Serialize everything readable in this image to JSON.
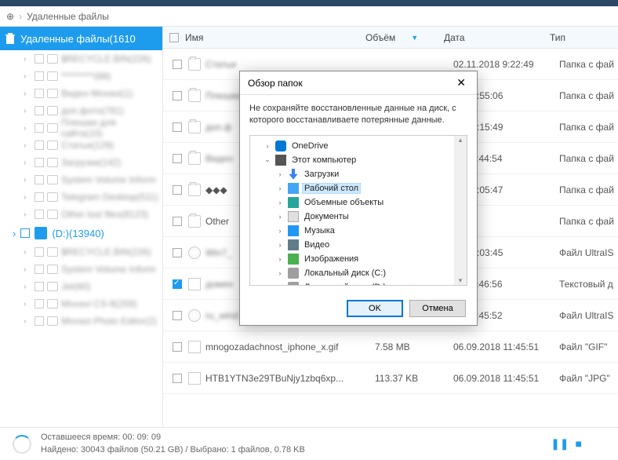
{
  "breadcrumb": {
    "title": "Удаленные файлы"
  },
  "sidebar": {
    "header": "Удаленные файлы(1610",
    "items": [
      "$RECYCLE.BIN(226)",
      "*********(68)",
      "Видео Movavi(1)",
      "доп.фото(781)",
      "Плюшки для сайта(10)",
      "Статьи(129)",
      "Загрузки(142)",
      "System Volume Inform",
      "Telegram Desktop(511)",
      "Other lost files(8123)"
    ],
    "disk_label": "(D:)(13940)",
    "items2": [
      "$RECYCLE.BIN(226)",
      "System Volume Inform",
      "Jet(60)",
      "Movavi CS-8(259)",
      "Movavi Photo Editor(2)"
    ]
  },
  "columns": {
    "name": "Имя",
    "size": "Объём",
    "date": "Дата",
    "type": "Тип"
  },
  "rows": [
    {
      "checked": false,
      "icon": "folder",
      "name": "Статьи",
      "blur": true,
      "size": "",
      "date": "02.11.2018 9:22:49",
      "type": "Папка с фай"
    },
    {
      "checked": false,
      "icon": "folder",
      "name": "Плюшки",
      "blur": true,
      "size": "",
      "date": "18 17:55:06",
      "type": "Папка с фай"
    },
    {
      "checked": false,
      "icon": "folder",
      "name": "доп.ф",
      "blur": true,
      "size": "",
      "date": "18 12:15:49",
      "type": "Папка с фай"
    },
    {
      "checked": false,
      "icon": "folder",
      "name": "Видео",
      "blur": true,
      "size": "",
      "date": "18 11:44:54",
      "type": "Папка с фай"
    },
    {
      "checked": false,
      "icon": "folder",
      "name": "◆◆◆",
      "blur": false,
      "size": "",
      "date": "18 15:05:47",
      "type": "Папка с фай"
    },
    {
      "checked": false,
      "icon": "folder",
      "name": "Other",
      "blur": false,
      "size": "",
      "date": "",
      "type": "Папка с фай"
    },
    {
      "checked": false,
      "icon": "iso",
      "name": "Win7_",
      "blur": true,
      "size": "",
      "date": "18 14:03:45",
      "type": "Файл UltraIS"
    },
    {
      "checked": true,
      "icon": "doc",
      "name": "домен",
      "blur": true,
      "size": "",
      "date": "18 11:46:56",
      "type": "Текстовый д"
    },
    {
      "checked": false,
      "icon": "iso",
      "name": "ru_wind",
      "blur": true,
      "size": "",
      "date": "18 11:45:52",
      "type": "Файл UltraIS"
    },
    {
      "checked": false,
      "icon": "doc",
      "name": "mnogozadachnost_iphone_x.gif",
      "blur": false,
      "size": "7.58 MB",
      "date": "06.09.2018 11:45:51",
      "type": "Файл \"GIF\""
    },
    {
      "checked": false,
      "icon": "doc",
      "name": "HTB1YTN3e29TBuNjy1zbq6xp...",
      "blur": false,
      "size": "113.37 KB",
      "date": "06.09.2018 11:45:51",
      "type": "Файл \"JPG\""
    }
  ],
  "status": {
    "line1": "Оставшееся время: 00: 09: 09",
    "line2": "Найдено: 30043 файлов (50.21 GB) / Выбрано: 1 файлов, 0.78 KB"
  },
  "dialog": {
    "title": "Обзор папок",
    "message": "Не сохраняйте восстановленные данные на диск, с которого восстанавливаете потерянные данные.",
    "tree": [
      {
        "indent": 1,
        "chev": "›",
        "icon": "cloud",
        "label": "OneDrive"
      },
      {
        "indent": 1,
        "chev": "⌄",
        "icon": "pc",
        "label": "Этот компьютер"
      },
      {
        "indent": 2,
        "chev": "›",
        "icon": "dl",
        "label": "Загрузки"
      },
      {
        "indent": 2,
        "chev": "›",
        "icon": "desktop",
        "label": "Рабочий стол",
        "selected": true
      },
      {
        "indent": 2,
        "chev": "›",
        "icon": "obj",
        "label": "Объемные объекты"
      },
      {
        "indent": 2,
        "chev": "›",
        "icon": "docs",
        "label": "Документы"
      },
      {
        "indent": 2,
        "chev": "›",
        "icon": "music",
        "label": "Музыка"
      },
      {
        "indent": 2,
        "chev": "›",
        "icon": "video",
        "label": "Видео"
      },
      {
        "indent": 2,
        "chev": "›",
        "icon": "img",
        "label": "Изображения"
      },
      {
        "indent": 2,
        "chev": "›",
        "icon": "disk",
        "label": "Локальный диск (C:)"
      },
      {
        "indent": 2,
        "chev": "›",
        "icon": "disk",
        "label": "Локальный диск (D:)"
      }
    ],
    "ok": "OK",
    "cancel": "Отмена"
  }
}
